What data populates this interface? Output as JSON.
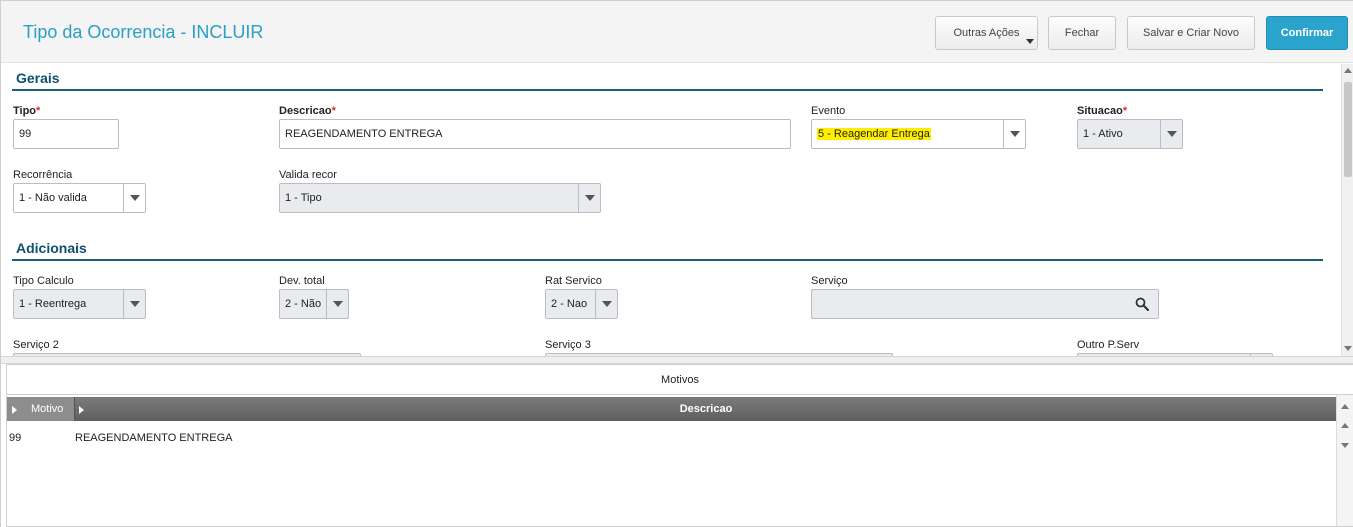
{
  "header": {
    "title": "Tipo da Ocorrencia - INCLUIR",
    "buttons": {
      "outras_acoes": "Outras Ações",
      "fechar": "Fechar",
      "salvar_criar_novo": "Salvar e Criar Novo",
      "confirmar": "Confirmar"
    }
  },
  "gerais": {
    "title": "Gerais",
    "tipo": {
      "label": "Tipo",
      "value": "99"
    },
    "descricao": {
      "label": "Descricao",
      "value": "REAGENDAMENTO ENTREGA"
    },
    "evento": {
      "label": "Evento",
      "value": "5 - Reagendar Entrega"
    },
    "situacao": {
      "label": "Situacao",
      "value": "1 - Ativo"
    },
    "recorrencia": {
      "label": "Recorrência",
      "value": "1 - Não valida"
    },
    "valida_recor": {
      "label": "Valida recor",
      "value": "1 - Tipo"
    }
  },
  "adicionais": {
    "title": "Adicionais",
    "tipo_calculo": {
      "label": "Tipo Calculo",
      "value": "1 - Reentrega"
    },
    "dev_total": {
      "label": "Dev. total",
      "value": "2 - Não"
    },
    "rat_servico": {
      "label": "Rat Servico",
      "value": "2 - Nao"
    },
    "servico": {
      "label": "Serviço",
      "value": ""
    },
    "servico2": {
      "label": "Serviço 2"
    },
    "servico3": {
      "label": "Serviço 3"
    },
    "outro_pserv": {
      "label": "Outro P.Serv"
    }
  },
  "required_mark": "*",
  "motivos": {
    "title": "Motivos",
    "columns": [
      "Motivo",
      "Descricao"
    ],
    "rows": [
      {
        "motivo": "99",
        "descricao": "REAGENDAMENTO ENTREGA"
      }
    ]
  },
  "icons": {
    "search": "search-icon",
    "dropdown": "chevron-down-icon"
  },
  "colors": {
    "accent": "#2aa3cd",
    "title": "#2a9fc7",
    "section": "#0f5070",
    "highlight": "#ffee00",
    "required": "#d0312d"
  }
}
